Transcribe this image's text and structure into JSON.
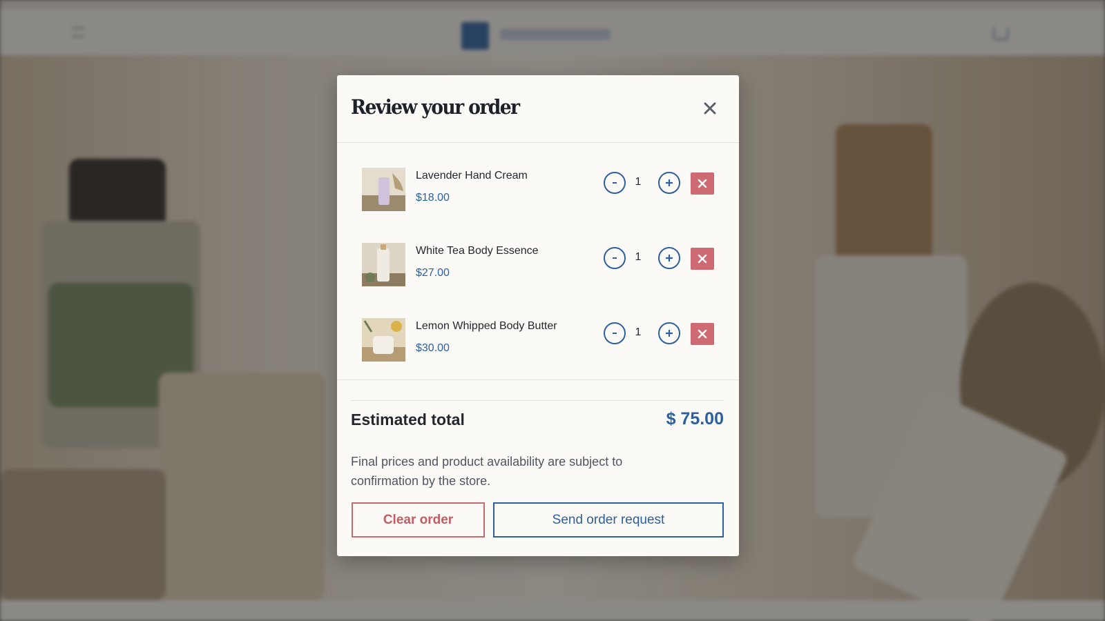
{
  "modal": {
    "title": "Review your order",
    "close_icon": "close-icon"
  },
  "items": [
    {
      "name": "Lavender Hand Cream",
      "price": "$18.00",
      "quantity": "1"
    },
    {
      "name": "White Tea Body Essence",
      "price": "$27.00",
      "quantity": "1"
    },
    {
      "name": "Lemon Whipped Body Butter",
      "price": "$30.00",
      "quantity": "1"
    }
  ],
  "summary": {
    "total_label": "Estimated total",
    "total_value": "$ 75.00",
    "disclaimer": "Final prices and product availability are subject to confirmation by the store.",
    "clear_label": "Clear order",
    "send_label": "Send order request"
  },
  "icons": {
    "decrease": "minus-icon",
    "increase": "plus-icon",
    "remove": "close-icon",
    "header_menu": "menu-icon",
    "header_cart": "cart-icon"
  },
  "colors": {
    "accent": "#2c5f9e",
    "danger": "#cd6a72",
    "modal_bg": "#fbfaf7",
    "text": "#23272e"
  }
}
